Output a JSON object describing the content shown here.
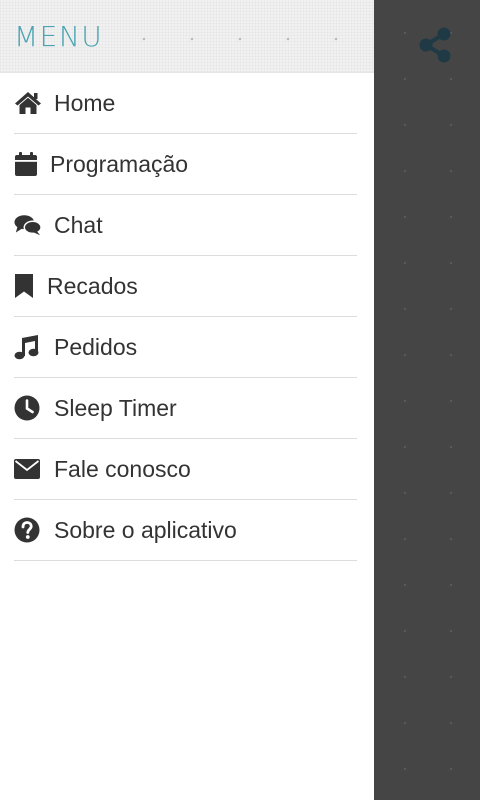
{
  "header": {
    "title": "MENU",
    "accent_color": "#4aa3b3"
  },
  "menu": {
    "items": [
      {
        "label": "Home",
        "icon": "home-icon"
      },
      {
        "label": "Programação",
        "icon": "calendar-icon"
      },
      {
        "label": "Chat",
        "icon": "chat-icon"
      },
      {
        "label": "Recados",
        "icon": "bookmark-icon"
      },
      {
        "label": "Pedidos",
        "icon": "music-note-icon"
      },
      {
        "label": "Sleep Timer",
        "icon": "clock-icon"
      },
      {
        "label": "Fale conosco",
        "icon": "envelope-icon"
      },
      {
        "label": "Sobre o aplicativo",
        "icon": "question-circle-icon"
      }
    ]
  },
  "toolbar": {
    "share_icon": "share-icon",
    "share_color": "#1f3a45"
  },
  "colors": {
    "text": "#333333",
    "backdrop": "#454545"
  }
}
